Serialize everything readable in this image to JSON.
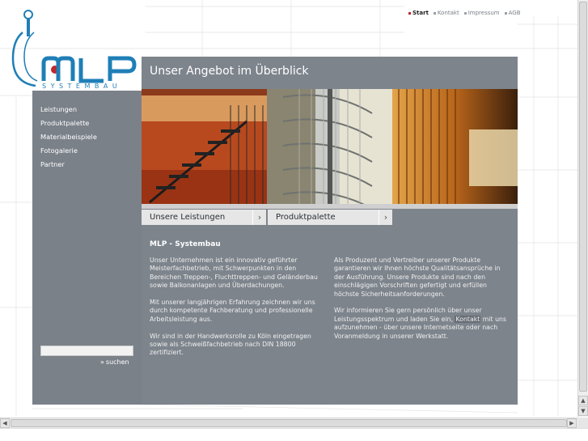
{
  "top_nav": [
    {
      "label": "Start",
      "active": true
    },
    {
      "label": "Kontakt",
      "active": false
    },
    {
      "label": "Impressum",
      "active": false
    },
    {
      "label": "AGB",
      "active": false
    }
  ],
  "logo": {
    "letters": "MLP",
    "sub": "SYSTEMBAU",
    "brand_color": "#1f7fb7",
    "dot_color": "#c0272d"
  },
  "sidebar": {
    "items": [
      {
        "label": "Leistungen"
      },
      {
        "label": "Produktpalette"
      },
      {
        "label": "Materialbeispiele"
      },
      {
        "label": "Fotogalerie"
      },
      {
        "label": "Partner"
      }
    ],
    "search_value": "",
    "search_button": "suchen"
  },
  "main": {
    "title": "Unser Angebot im Überblick",
    "tabs": [
      {
        "label": "Unsere Leistungen"
      },
      {
        "label": "Produktpalette"
      }
    ],
    "content_title": "MLP - Systembau",
    "left_paragraphs": [
      "Unser Unternehmen ist ein innovativ geführter Meisterfachbetrieb, mit Schwerpunkten in den Bereichen Treppen-, Fluchttreppen- und Geländerbau sowie Balkonanlagen und Überdachungen.",
      "Mit unserer langjährigen Erfahrung zeichnen wir uns durch kompetente Fachberatung und professionelle Arbeitsleistung aus.",
      "Wir sind in der Handwerksrolle zu Köln eingetragen sowie als Schweißfachbetrieb nach DIN 18800 zertifiziert."
    ],
    "right_paragraph_1": "Als Produzent und Vertreiber unserer Produkte garantieren wir Ihnen höchste Qualitätsansprüche in der Ausführung. Unsere Produkte sind nach den einschlägigen Vorschriften gefertigt und erfüllen höchste Sicherheitsanforderungen.",
    "right_paragraph_2_before": "Wir informieren Sie gern persönlich über unser Leistungsspektrum und laden Sie ein, ",
    "right_paragraph_2_link": "Kontakt",
    "right_paragraph_2_after": " mit uns aufzunehmen - über unsere Internetseite oder nach Voranmeldung in unserer Werkstatt."
  },
  "colors": {
    "panel": "#7d848c",
    "sidebar": "#7b8189",
    "tab_bg": "#e6e6e6"
  }
}
